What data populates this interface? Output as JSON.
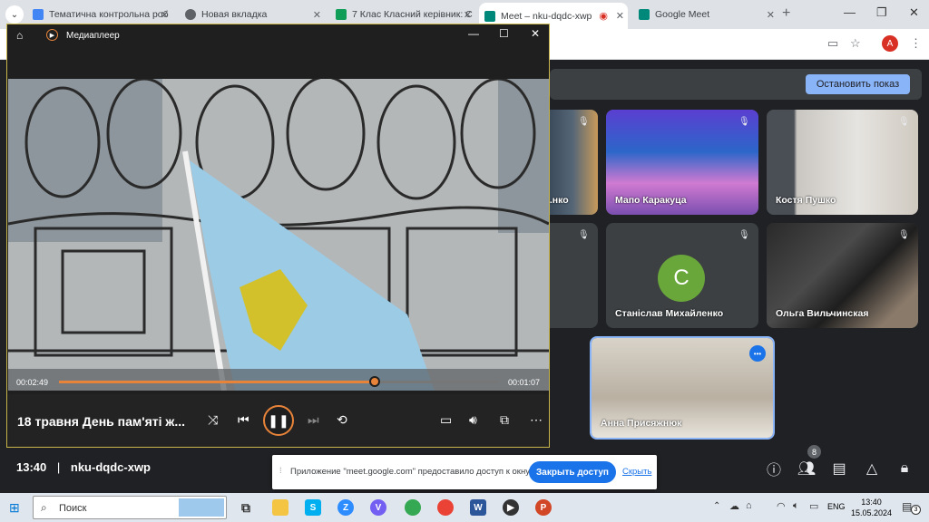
{
  "browser": {
    "tabs": [
      {
        "label": "Тематична контрольна роб",
        "color": "#1a73e8"
      },
      {
        "label": "Новая вкладка",
        "color": "#5f6368"
      },
      {
        "label": "7 Клас Класний керівник: C",
        "color": "#0f9d58"
      },
      {
        "label": "Meet – nku-dqdc-xwp",
        "color": "#00897b",
        "active": true
      },
      {
        "label": "Google Meet",
        "color": "#00897b"
      }
    ],
    "avatar_letter": "A"
  },
  "meet": {
    "stop_presenting": "Остановить показ",
    "participants": [
      {
        "name": "...нко"
      },
      {
        "name": "Мапо Каракуца"
      },
      {
        "name": "Костя Пушко"
      },
      {
        "name": "Станіслав Михайленко",
        "initial": "С"
      },
      {
        "name": "Ольга Вильчинская"
      },
      {
        "name": "Анна Присяжнюк"
      }
    ],
    "time": "13:40",
    "separator": "|",
    "code": "nku-dqdc-xwp",
    "people_count": "8"
  },
  "notification": {
    "text": "Приложение \"meet.google.com\" предоставило доступ к окну.",
    "close_button": "Закрыть доступ",
    "hide_link": "Скрыть"
  },
  "player": {
    "title": "Медиаплеер",
    "elapsed": "00:02:49",
    "remaining": "00:01:07",
    "progress": 0.72,
    "track_title": "18 травня День пам'яті ж..."
  },
  "taskbar": {
    "search_placeholder": "Поиск",
    "lang": "ENG",
    "time": "13:40",
    "date": "15.05.2024",
    "notifications": "3"
  }
}
